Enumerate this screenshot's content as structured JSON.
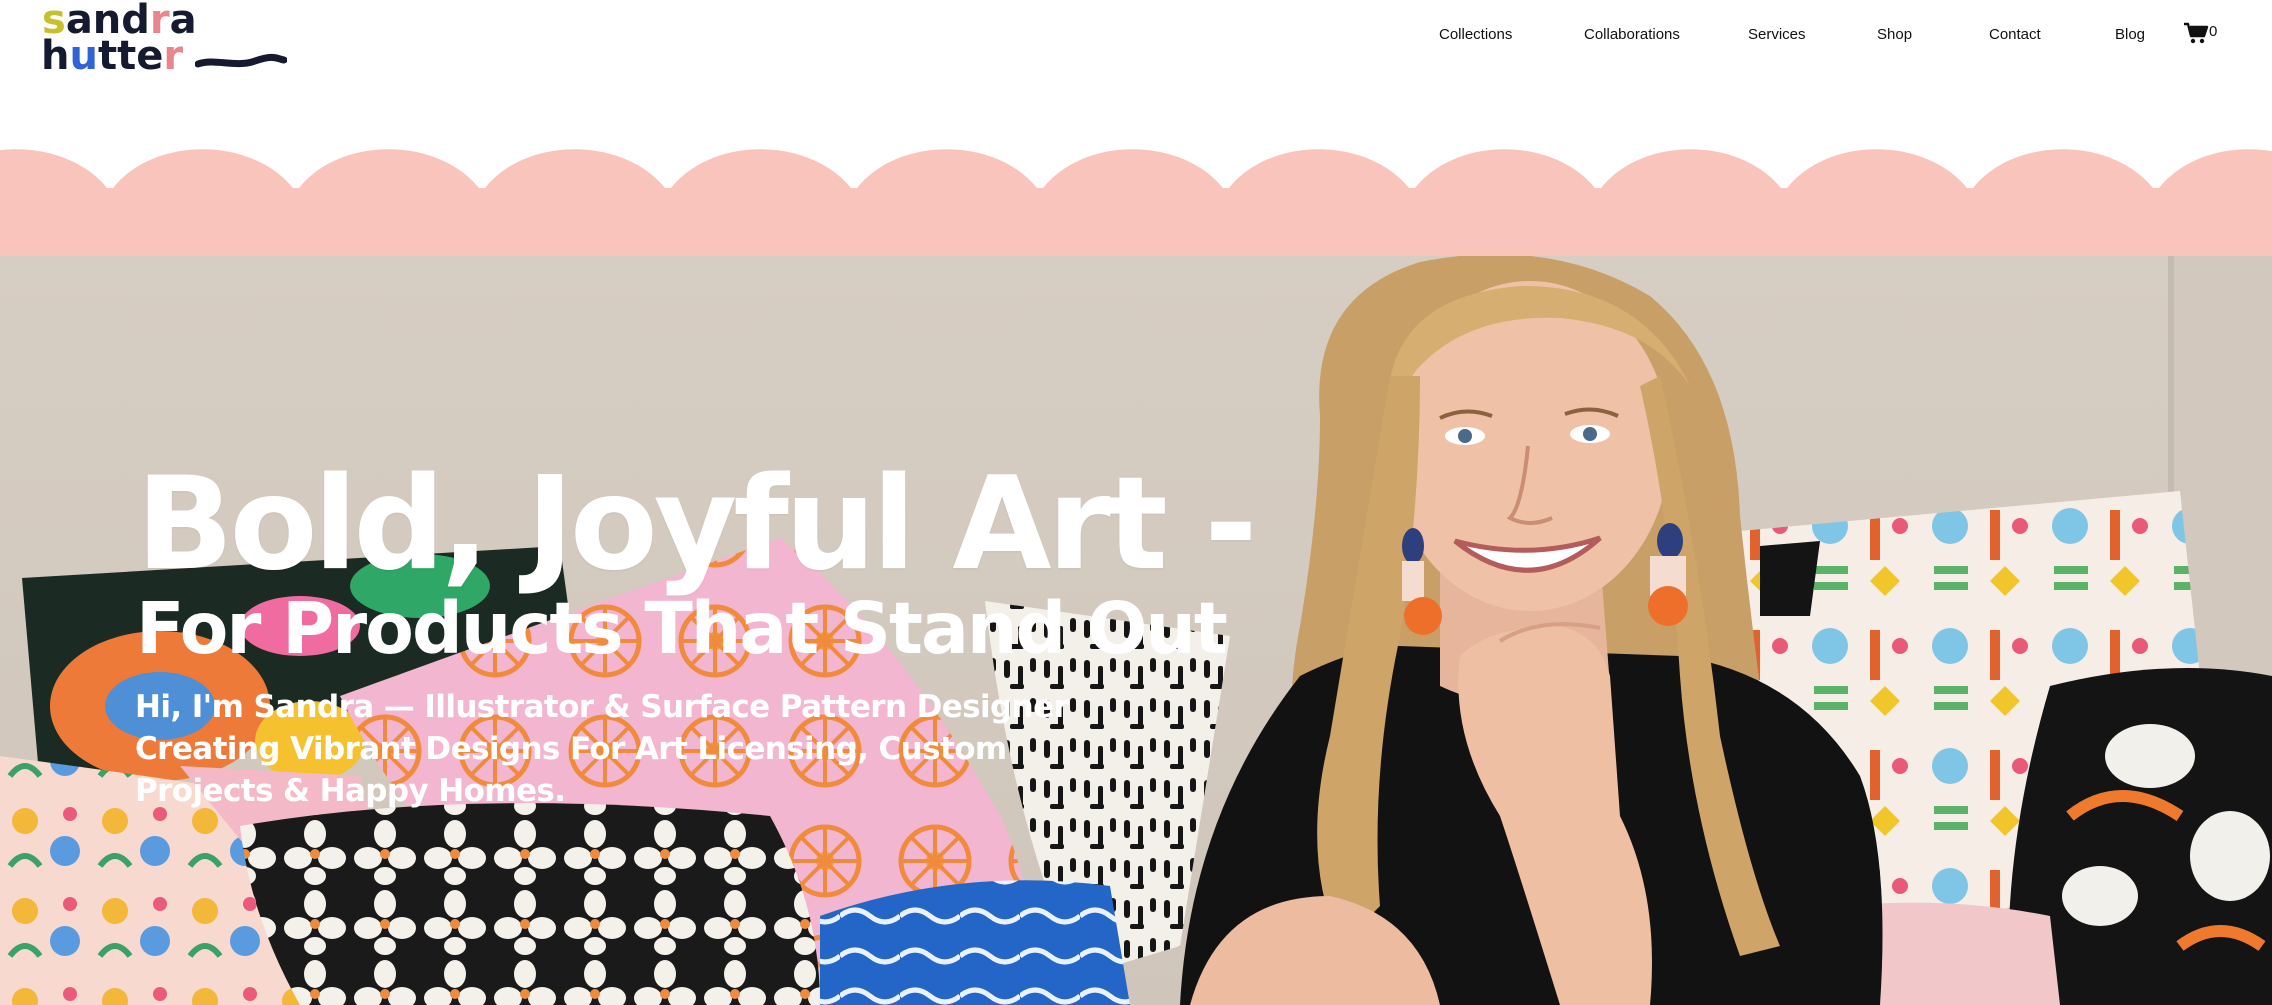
{
  "logo": {
    "line1": [
      "s",
      "and",
      "r",
      "a"
    ],
    "line2": [
      "h",
      "u",
      "tte",
      "r"
    ]
  },
  "nav": {
    "items": [
      "Collections",
      "Collaborations",
      "Services",
      "Shop",
      "Contact",
      "Blog"
    ],
    "cart_icon": "shopping-cart-icon",
    "cart_count": "0"
  },
  "colors": {
    "band_pink": "#f8c4bc",
    "logo_yellow": "#c6c02a",
    "logo_pink": "#e8858d",
    "logo_blue": "#2f63d6",
    "logo_dark": "#161a2e",
    "hero_text": "#ffffff"
  },
  "hero": {
    "headline": "Bold, Joyful Art -",
    "subheadline": "For Products That Stand Out",
    "intro": "Hi, I'm Sandra — Illustrator & Surface Pattern Designer Creating Vibrant Designs For Art Licensing, Custom Projects & Happy Homes."
  }
}
